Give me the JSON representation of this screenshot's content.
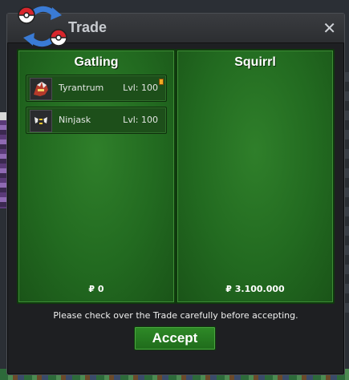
{
  "window": {
    "title": "Trade",
    "close_glyph": "✕",
    "logo_icon": "pokeball-swap-icon"
  },
  "panels": [
    {
      "player": "Gatling",
      "money": "₽ 0",
      "items": [
        {
          "name": "Tyrantrum",
          "level": "Lvl: 100",
          "icon": "tyrantrum-sprite-icon",
          "has_marker": true
        },
        {
          "name": "Ninjask",
          "level": "Lvl: 100",
          "icon": "ninjask-sprite-icon",
          "has_marker": false
        }
      ]
    },
    {
      "player": "Squirrl",
      "money": "₽ 3.100.000",
      "items": []
    }
  ],
  "notice": "Please check over the Trade carefully before accepting.",
  "accept_label": "Accept",
  "colors": {
    "panel_green": "#226a20",
    "button_green": "#2e8a27",
    "marker_orange": "#f2a922"
  }
}
